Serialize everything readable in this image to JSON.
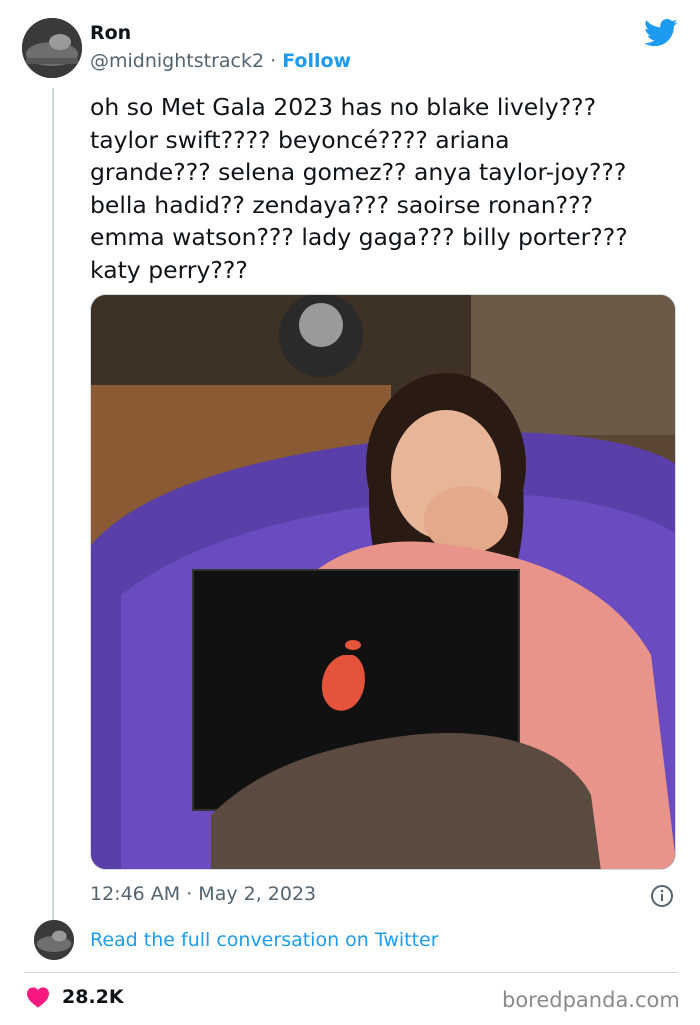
{
  "author": {
    "name": "Ron",
    "handle": "@midnightstrack2",
    "separator": "·",
    "follow_label": "Follow"
  },
  "tweet": {
    "lines": [
      "oh so Met Gala 2023 has no blake lively???",
      "taylor swift???? beyoncé???? ariana",
      "grande??? selena gomez?? anya taylor-joy???",
      "bella hadid?? zendaya??? saoirse ronan???",
      "emma watson??? lady gaga??? billy porter???",
      "katy perry???"
    ],
    "timestamp": "12:46 AM · May 2, 2023"
  },
  "conversation_link": "Read the full conversation on Twitter",
  "likes": "28.2K",
  "watermark": "boredpanda.com",
  "colors": {
    "link_blue": "#1d9bf0",
    "heart_pink": "#f91880",
    "secondary_text": "#536471"
  },
  "icons": [
    "twitter-bird-icon",
    "info-icon",
    "heart-icon"
  ]
}
